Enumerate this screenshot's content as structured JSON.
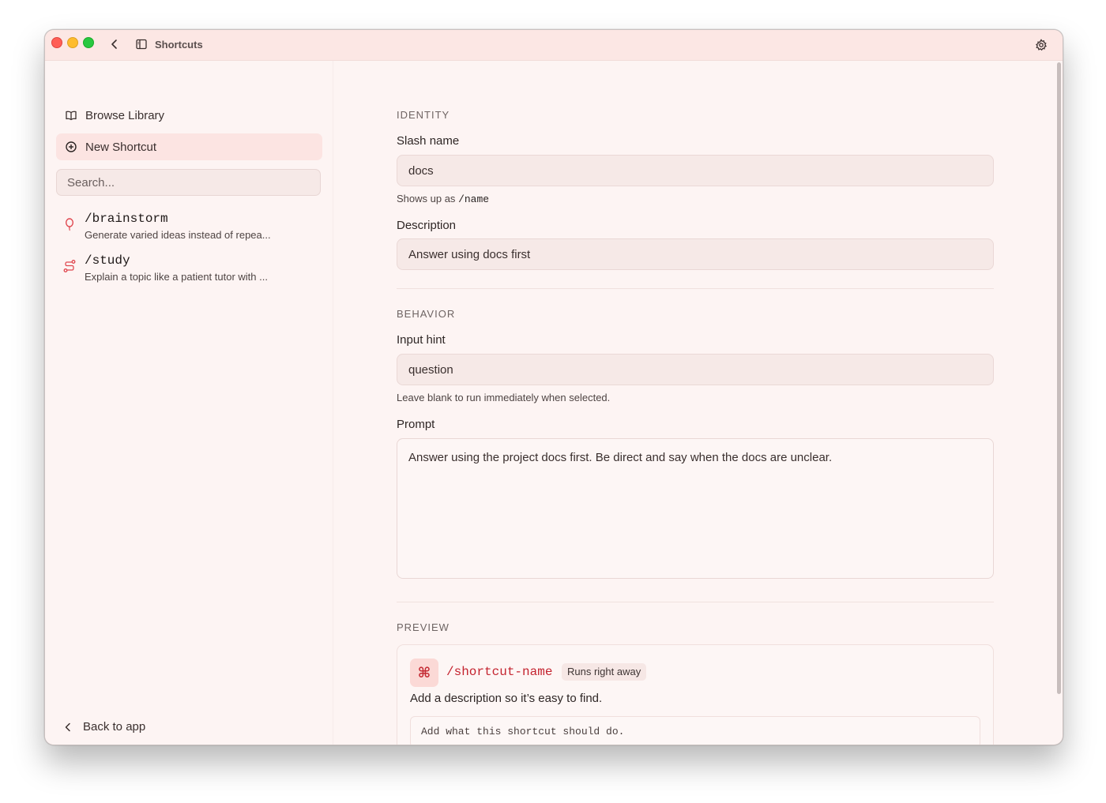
{
  "window": {
    "title": "Shortcuts"
  },
  "sidebar": {
    "browse_label": "Browse Library",
    "new_label": "New Shortcut",
    "search_placeholder": "Search...",
    "shortcuts": [
      {
        "name": "/brainstorm",
        "description": "Generate varied ideas instead of repea...",
        "icon": "balloon-icon"
      },
      {
        "name": "/study",
        "description": "Explain a topic like a patient tutor with ...",
        "icon": "route-icon"
      }
    ],
    "back_label": "Back to app"
  },
  "form": {
    "identity_heading": "IDENTITY",
    "slash_name_label": "Slash name",
    "slash_name_value": "docs",
    "slash_hint_prefix": "Shows up as",
    "slash_hint_code": "/name",
    "description_label": "Description",
    "description_value": "Answer using docs first",
    "behavior_heading": "BEHAVIOR",
    "input_hint_label": "Input hint",
    "input_hint_value": "question",
    "input_hint_help": "Leave blank to run immediately when selected.",
    "prompt_label": "Prompt",
    "prompt_value": "Answer using the project docs first. Be direct and say when the docs are unclear.",
    "preview_heading": "PREVIEW"
  },
  "preview": {
    "icon_glyph": "⌘",
    "name": "/shortcut-name",
    "badge": "Runs right away",
    "description": "Add a description so it’s easy to find.",
    "prompt_placeholder": "Add what this shortcut should do."
  },
  "colors": {
    "accent": "#c4232f",
    "sidebar_selected": "#fce4e2",
    "titlebar": "#fce7e4",
    "background": "#fdf4f3"
  }
}
